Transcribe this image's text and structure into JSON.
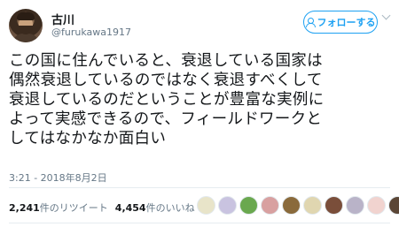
{
  "user": {
    "display_name": "古川",
    "handle": "@furukawa1917"
  },
  "follow_button": {
    "label": "フォローする"
  },
  "tweet": {
    "text": "この国に住んでいると、衰退している国家は\n偶然衰退しているのではなく衰退すべくして\n衰退しているのだということが豊富な実例に\nよって実感できるので、フィールドワークと\nしてはなかなか面白い",
    "timestamp": "3:21 - 2018年8月2日"
  },
  "stats": {
    "retweet_count": "2,241",
    "retweet_label": "件のリツイート",
    "like_count": "4,454",
    "like_label": "件のいいね"
  },
  "liker_avatars": [
    {
      "color": "#e8e4c9"
    },
    {
      "color": "#c9c3e0"
    },
    {
      "color": "#6aa84f"
    },
    {
      "color": "#d8a0a0"
    },
    {
      "color": "#8a6a3b"
    },
    {
      "color": "#e0d6b0"
    },
    {
      "color": "#7a4e3a"
    },
    {
      "color": "#b9b3c8"
    },
    {
      "color": "#f1d3cf"
    },
    {
      "color": "#5b4636"
    }
  ],
  "colors": {
    "accent": "#1da1f2",
    "text": "#14171a",
    "muted": "#657786"
  }
}
